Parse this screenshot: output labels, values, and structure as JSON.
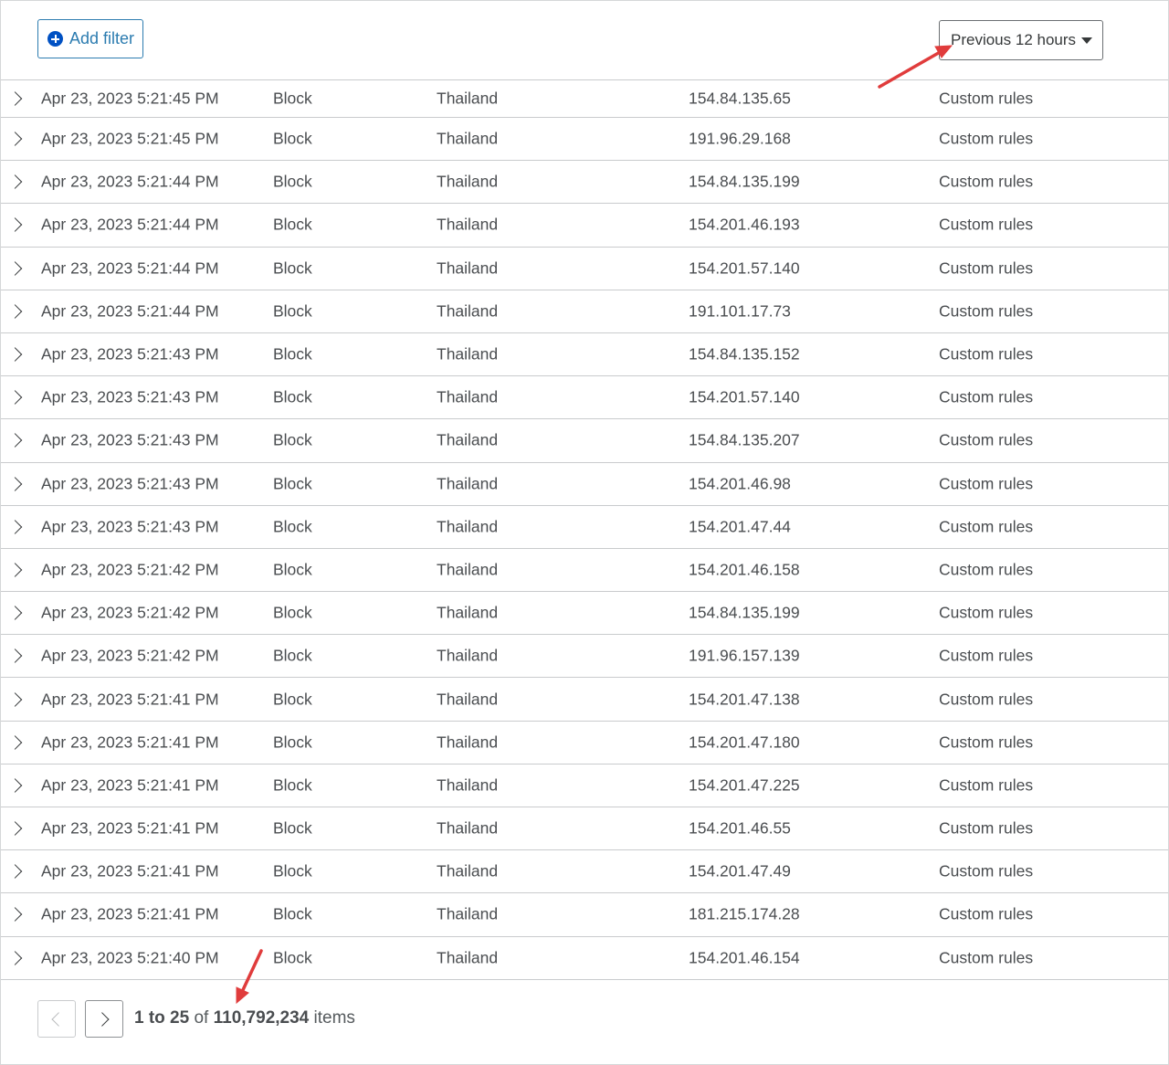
{
  "toolbar": {
    "add_filter_label": "Add filter",
    "time_range_label": "Previous 12 hours"
  },
  "events": [
    {
      "date": "Apr 23, 2023 5:21:45 PM",
      "action": "Block",
      "country": "Thailand",
      "ip": "154.84.135.65",
      "source": "Custom rules"
    },
    {
      "date": "Apr 23, 2023 5:21:45 PM",
      "action": "Block",
      "country": "Thailand",
      "ip": "191.96.29.168",
      "source": "Custom rules"
    },
    {
      "date": "Apr 23, 2023 5:21:44 PM",
      "action": "Block",
      "country": "Thailand",
      "ip": "154.84.135.199",
      "source": "Custom rules"
    },
    {
      "date": "Apr 23, 2023 5:21:44 PM",
      "action": "Block",
      "country": "Thailand",
      "ip": "154.201.46.193",
      "source": "Custom rules"
    },
    {
      "date": "Apr 23, 2023 5:21:44 PM",
      "action": "Block",
      "country": "Thailand",
      "ip": "154.201.57.140",
      "source": "Custom rules"
    },
    {
      "date": "Apr 23, 2023 5:21:44 PM",
      "action": "Block",
      "country": "Thailand",
      "ip": "191.101.17.73",
      "source": "Custom rules"
    },
    {
      "date": "Apr 23, 2023 5:21:43 PM",
      "action": "Block",
      "country": "Thailand",
      "ip": "154.84.135.152",
      "source": "Custom rules"
    },
    {
      "date": "Apr 23, 2023 5:21:43 PM",
      "action": "Block",
      "country": "Thailand",
      "ip": "154.201.57.140",
      "source": "Custom rules"
    },
    {
      "date": "Apr 23, 2023 5:21:43 PM",
      "action": "Block",
      "country": "Thailand",
      "ip": "154.84.135.207",
      "source": "Custom rules"
    },
    {
      "date": "Apr 23, 2023 5:21:43 PM",
      "action": "Block",
      "country": "Thailand",
      "ip": "154.201.46.98",
      "source": "Custom rules"
    },
    {
      "date": "Apr 23, 2023 5:21:43 PM",
      "action": "Block",
      "country": "Thailand",
      "ip": "154.201.47.44",
      "source": "Custom rules"
    },
    {
      "date": "Apr 23, 2023 5:21:42 PM",
      "action": "Block",
      "country": "Thailand",
      "ip": "154.201.46.158",
      "source": "Custom rules"
    },
    {
      "date": "Apr 23, 2023 5:21:42 PM",
      "action": "Block",
      "country": "Thailand",
      "ip": "154.84.135.199",
      "source": "Custom rules"
    },
    {
      "date": "Apr 23, 2023 5:21:42 PM",
      "action": "Block",
      "country": "Thailand",
      "ip": "191.96.157.139",
      "source": "Custom rules"
    },
    {
      "date": "Apr 23, 2023 5:21:41 PM",
      "action": "Block",
      "country": "Thailand",
      "ip": "154.201.47.138",
      "source": "Custom rules"
    },
    {
      "date": "Apr 23, 2023 5:21:41 PM",
      "action": "Block",
      "country": "Thailand",
      "ip": "154.201.47.180",
      "source": "Custom rules"
    },
    {
      "date": "Apr 23, 2023 5:21:41 PM",
      "action": "Block",
      "country": "Thailand",
      "ip": "154.201.47.225",
      "source": "Custom rules"
    },
    {
      "date": "Apr 23, 2023 5:21:41 PM",
      "action": "Block",
      "country": "Thailand",
      "ip": "154.201.46.55",
      "source": "Custom rules"
    },
    {
      "date": "Apr 23, 2023 5:21:41 PM",
      "action": "Block",
      "country": "Thailand",
      "ip": "154.201.47.49",
      "source": "Custom rules"
    },
    {
      "date": "Apr 23, 2023 5:21:41 PM",
      "action": "Block",
      "country": "Thailand",
      "ip": "181.215.174.28",
      "source": "Custom rules"
    },
    {
      "date": "Apr 23, 2023 5:21:40 PM",
      "action": "Block",
      "country": "Thailand",
      "ip": "154.201.46.154",
      "source": "Custom rules"
    }
  ],
  "pagination": {
    "range": "1 to 25",
    "of_word": "of",
    "total": "110,792,234",
    "items_word": "items"
  },
  "colors": {
    "accent": "#2c7cb0",
    "annotation_arrow": "#e03c3c"
  },
  "icons": {
    "add_filter": "plus-circle-icon",
    "time_range": "caret-down-icon",
    "row_expand": "chevron-right-icon",
    "prev_page": "chevron-left-icon",
    "next_page": "chevron-right-icon"
  }
}
